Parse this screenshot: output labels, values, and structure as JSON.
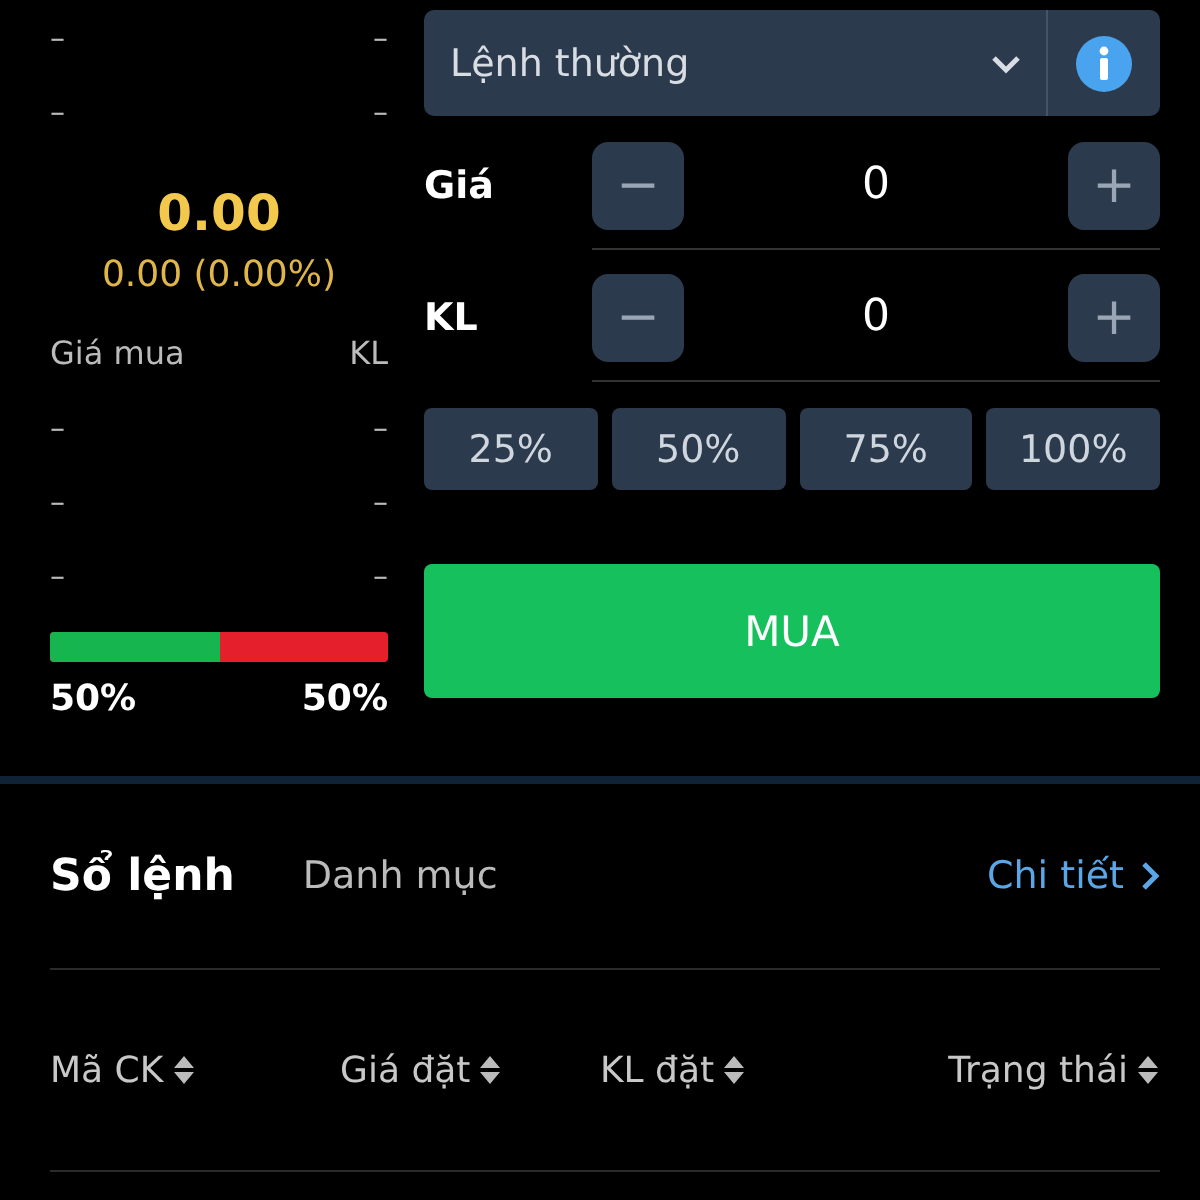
{
  "order_book": {
    "asks": [
      {
        "price": "–",
        "volume": "–"
      },
      {
        "price": "–",
        "volume": "–"
      }
    ],
    "last_price": "0.00",
    "change": "0.00 (0.00%)",
    "header_price": "Giá mua",
    "header_volume": "KL",
    "bids": [
      {
        "price": "–",
        "volume": "–"
      },
      {
        "price": "–",
        "volume": "–"
      },
      {
        "price": "–",
        "volume": "–"
      }
    ],
    "ratio": {
      "level": 0.5,
      "buy_label": "50%",
      "sell_label": "50%"
    }
  },
  "order_form": {
    "order_type": "Lệnh thường",
    "steppers": [
      {
        "label": "Giá",
        "minus": "−",
        "value": "0",
        "plus": "+"
      },
      {
        "label": "KL",
        "minus": "−",
        "value": "0",
        "plus": "+"
      }
    ],
    "percent_buttons": [
      "25%",
      "50%",
      "75%",
      "100%"
    ],
    "submit": "MUA"
  },
  "tabs": [
    {
      "label": "Sổ lệnh",
      "selected": true
    },
    {
      "label": "Danh mục",
      "selected": false
    }
  ],
  "detail_link": "Chi tiết",
  "table": {
    "columns": [
      "Mã CK",
      "Giá đặt",
      "KL đặt",
      "Trạng thái"
    ]
  }
}
